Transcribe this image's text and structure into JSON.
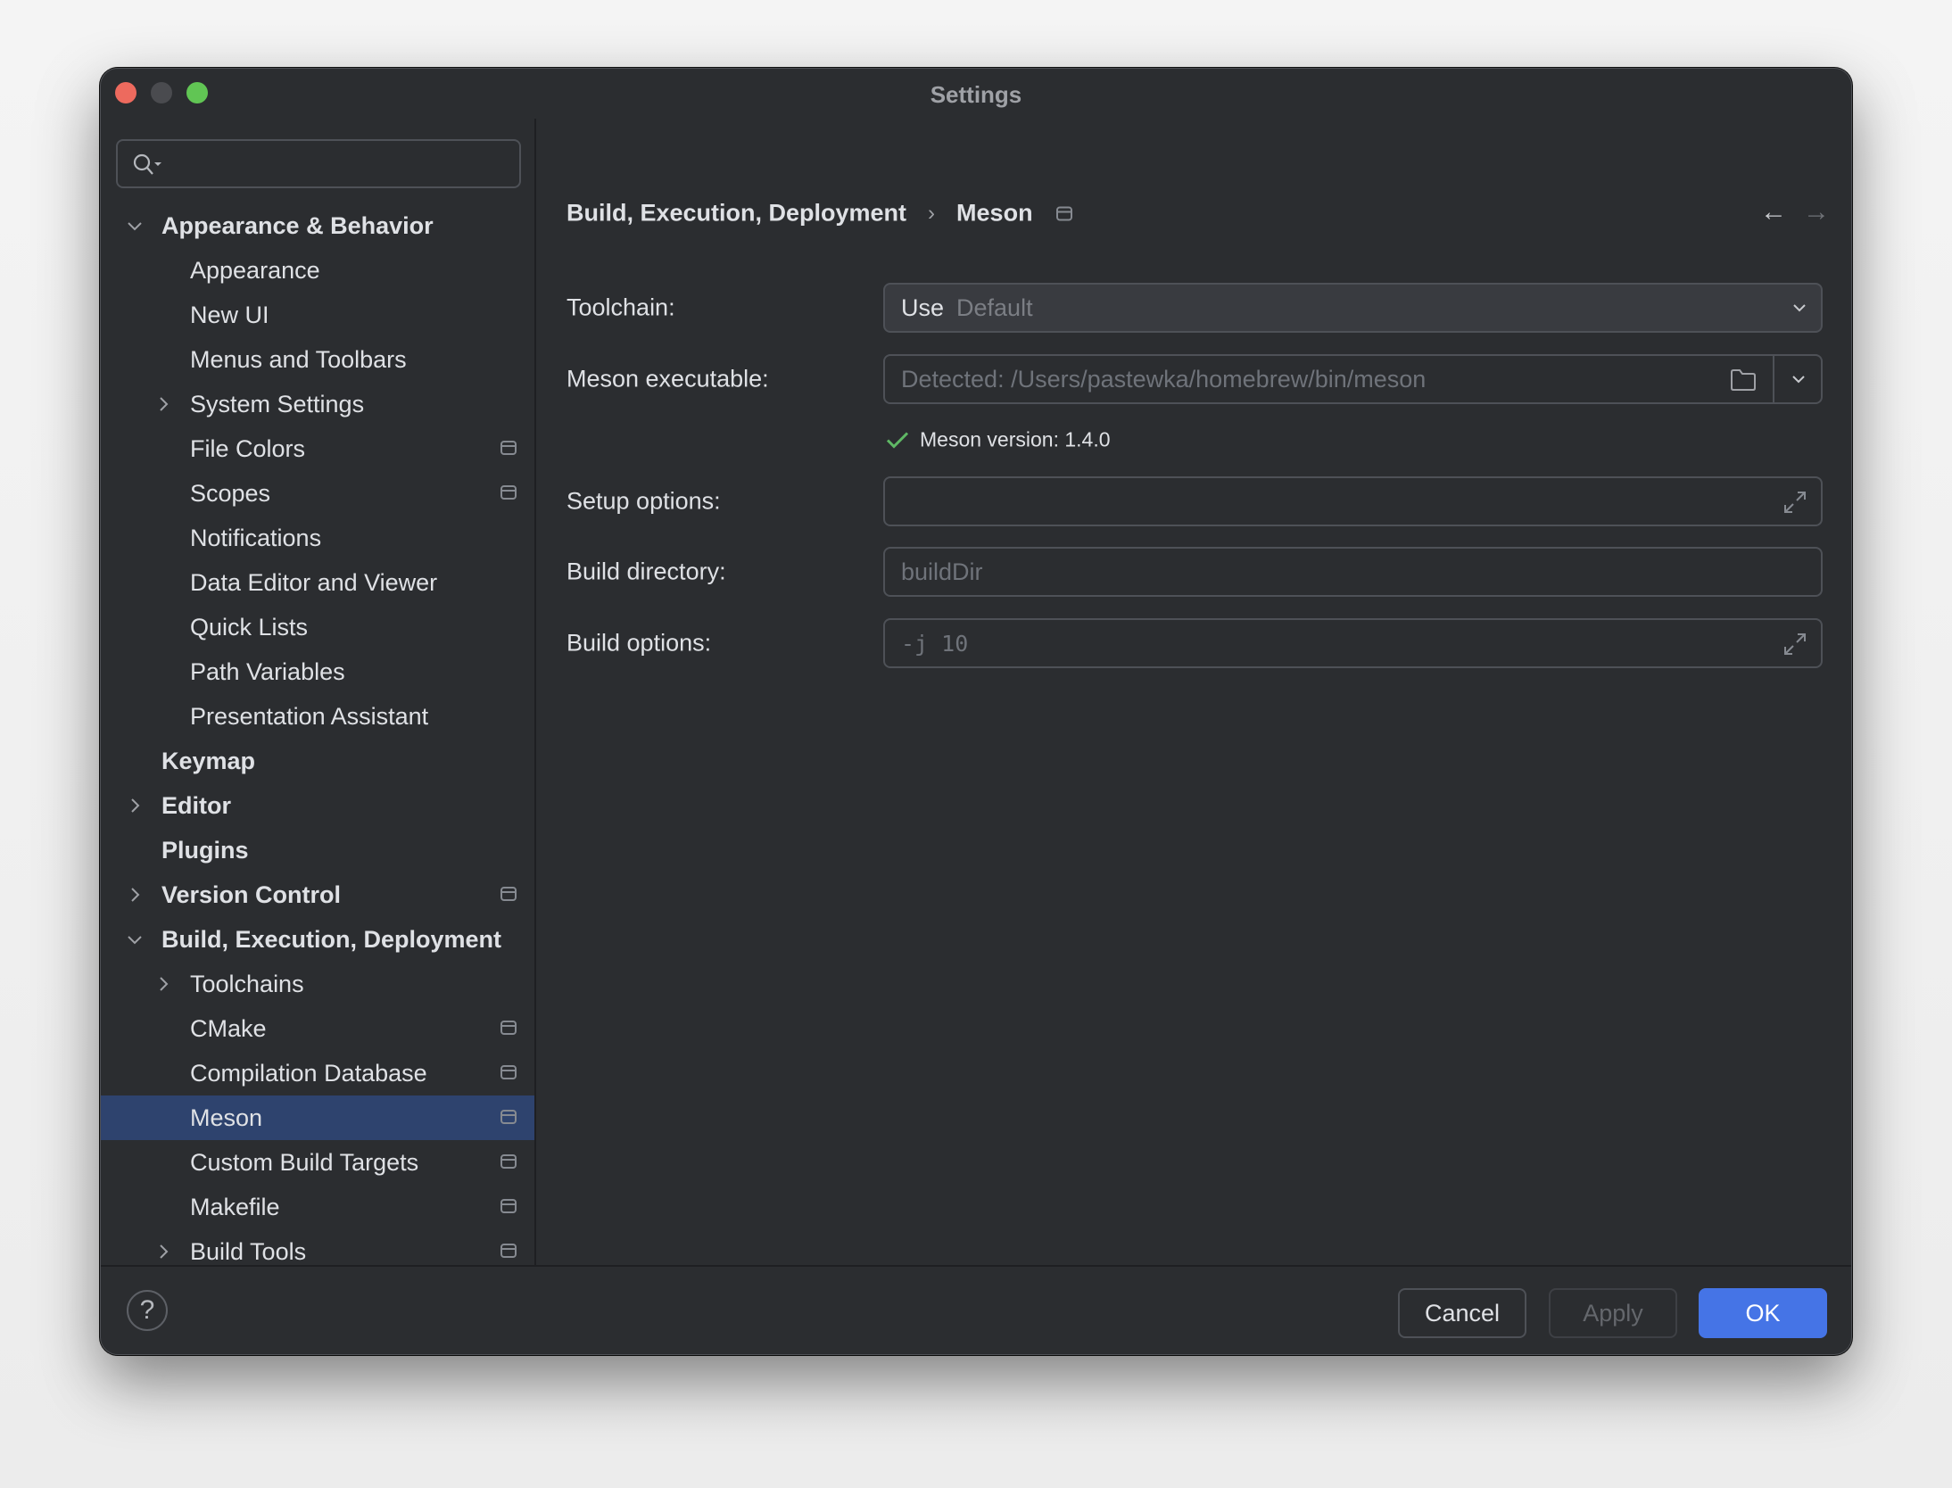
{
  "window": {
    "title": "Settings",
    "traffic_lights": {
      "close": "#ed6a5e",
      "minimize": "#4a4b4f",
      "maximize": "#61c554"
    }
  },
  "sidebar": {
    "search": {
      "value": "",
      "placeholder": "",
      "icon": "search-with-dropdown-icon"
    },
    "items": [
      {
        "label": "Appearance & Behavior",
        "level": 0,
        "bold": true,
        "chevron": "down",
        "project": false
      },
      {
        "label": "Appearance",
        "level": 1,
        "bold": false,
        "chevron": null,
        "project": false
      },
      {
        "label": "New UI",
        "level": 1,
        "bold": false,
        "chevron": null,
        "project": false
      },
      {
        "label": "Menus and Toolbars",
        "level": 1,
        "bold": false,
        "chevron": null,
        "project": false
      },
      {
        "label": "System Settings",
        "level": 1,
        "bold": false,
        "chevron": "right",
        "project": false
      },
      {
        "label": "File Colors",
        "level": 1,
        "bold": false,
        "chevron": null,
        "project": true
      },
      {
        "label": "Scopes",
        "level": 1,
        "bold": false,
        "chevron": null,
        "project": true
      },
      {
        "label": "Notifications",
        "level": 1,
        "bold": false,
        "chevron": null,
        "project": false
      },
      {
        "label": "Data Editor and Viewer",
        "level": 1,
        "bold": false,
        "chevron": null,
        "project": false
      },
      {
        "label": "Quick Lists",
        "level": 1,
        "bold": false,
        "chevron": null,
        "project": false
      },
      {
        "label": "Path Variables",
        "level": 1,
        "bold": false,
        "chevron": null,
        "project": false
      },
      {
        "label": "Presentation Assistant",
        "level": 1,
        "bold": false,
        "chevron": null,
        "project": false
      },
      {
        "label": "Keymap",
        "level": 0,
        "bold": true,
        "chevron": null,
        "project": false
      },
      {
        "label": "Editor",
        "level": 0,
        "bold": true,
        "chevron": "right",
        "project": false
      },
      {
        "label": "Plugins",
        "level": 0,
        "bold": true,
        "chevron": null,
        "project": false
      },
      {
        "label": "Version Control",
        "level": 0,
        "bold": true,
        "chevron": "right",
        "project": true
      },
      {
        "label": "Build, Execution, Deployment",
        "level": 0,
        "bold": true,
        "chevron": "down",
        "project": false
      },
      {
        "label": "Toolchains",
        "level": 1,
        "bold": false,
        "chevron": "right",
        "project": false
      },
      {
        "label": "CMake",
        "level": 1,
        "bold": false,
        "chevron": null,
        "project": true
      },
      {
        "label": "Compilation Database",
        "level": 1,
        "bold": false,
        "chevron": null,
        "project": true
      },
      {
        "label": "Meson",
        "level": 1,
        "bold": false,
        "chevron": null,
        "project": true,
        "selected": true
      },
      {
        "label": "Custom Build Targets",
        "level": 1,
        "bold": false,
        "chevron": null,
        "project": true
      },
      {
        "label": "Makefile",
        "level": 1,
        "bold": false,
        "chevron": null,
        "project": true
      },
      {
        "label": "Build Tools",
        "level": 1,
        "bold": false,
        "chevron": "right",
        "project": true
      }
    ],
    "selected_color": "#2e436e"
  },
  "content": {
    "breadcrumb": {
      "parent": "Build, Execution, Deployment",
      "separator": "›",
      "current": "Meson"
    },
    "nav": {
      "back": "←",
      "forward": "→"
    },
    "form": {
      "toolchain": {
        "label": "Toolchain:",
        "prefix": "Use",
        "value": "Default"
      },
      "executable": {
        "label": "Meson executable:",
        "placeholder": "Detected: /Users/pastewka/homebrew/bin/meson"
      },
      "version": {
        "text": "Meson version: 1.4.0",
        "status_color": "#5fb865"
      },
      "setup_options": {
        "label": "Setup options:",
        "value": ""
      },
      "build_directory": {
        "label": "Build directory:",
        "placeholder": "buildDir"
      },
      "build_options": {
        "label": "Build options:",
        "placeholder": "-j 10"
      }
    }
  },
  "footer": {
    "help": "?",
    "cancel": "Cancel",
    "apply": "Apply",
    "ok": "OK",
    "accent": "#4574e6"
  }
}
